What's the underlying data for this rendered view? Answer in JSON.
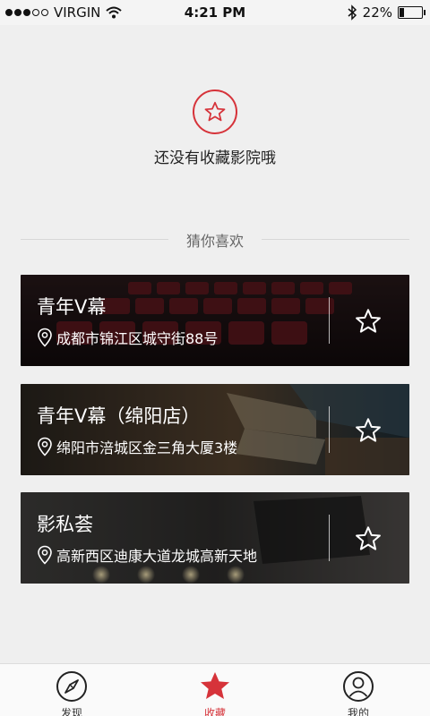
{
  "status_bar": {
    "carrier": "VIRGIN",
    "time": "4:21 PM",
    "battery": "22%",
    "battery_level": 0.22
  },
  "empty_state": {
    "icon": "star-icon",
    "text": "还没有收藏影院哦"
  },
  "guess": {
    "title": "猜你喜欢"
  },
  "cinemas": [
    {
      "name": "青年V幕",
      "address": "成都市锦江区城守街88号"
    },
    {
      "name": "青年V幕（绵阳店）",
      "address": "绵阳市涪城区金三角大厦3楼"
    },
    {
      "name": "影私荟",
      "address": "高新西区迪康大道龙城高新天地"
    }
  ],
  "tabs": [
    {
      "label": "发现",
      "icon": "compass-icon"
    },
    {
      "label": "收藏",
      "icon": "star-icon",
      "active": true
    },
    {
      "label": "我的",
      "icon": "user-icon"
    }
  ],
  "colors": {
    "accent": "#d6333a",
    "background": "#efefef"
  }
}
